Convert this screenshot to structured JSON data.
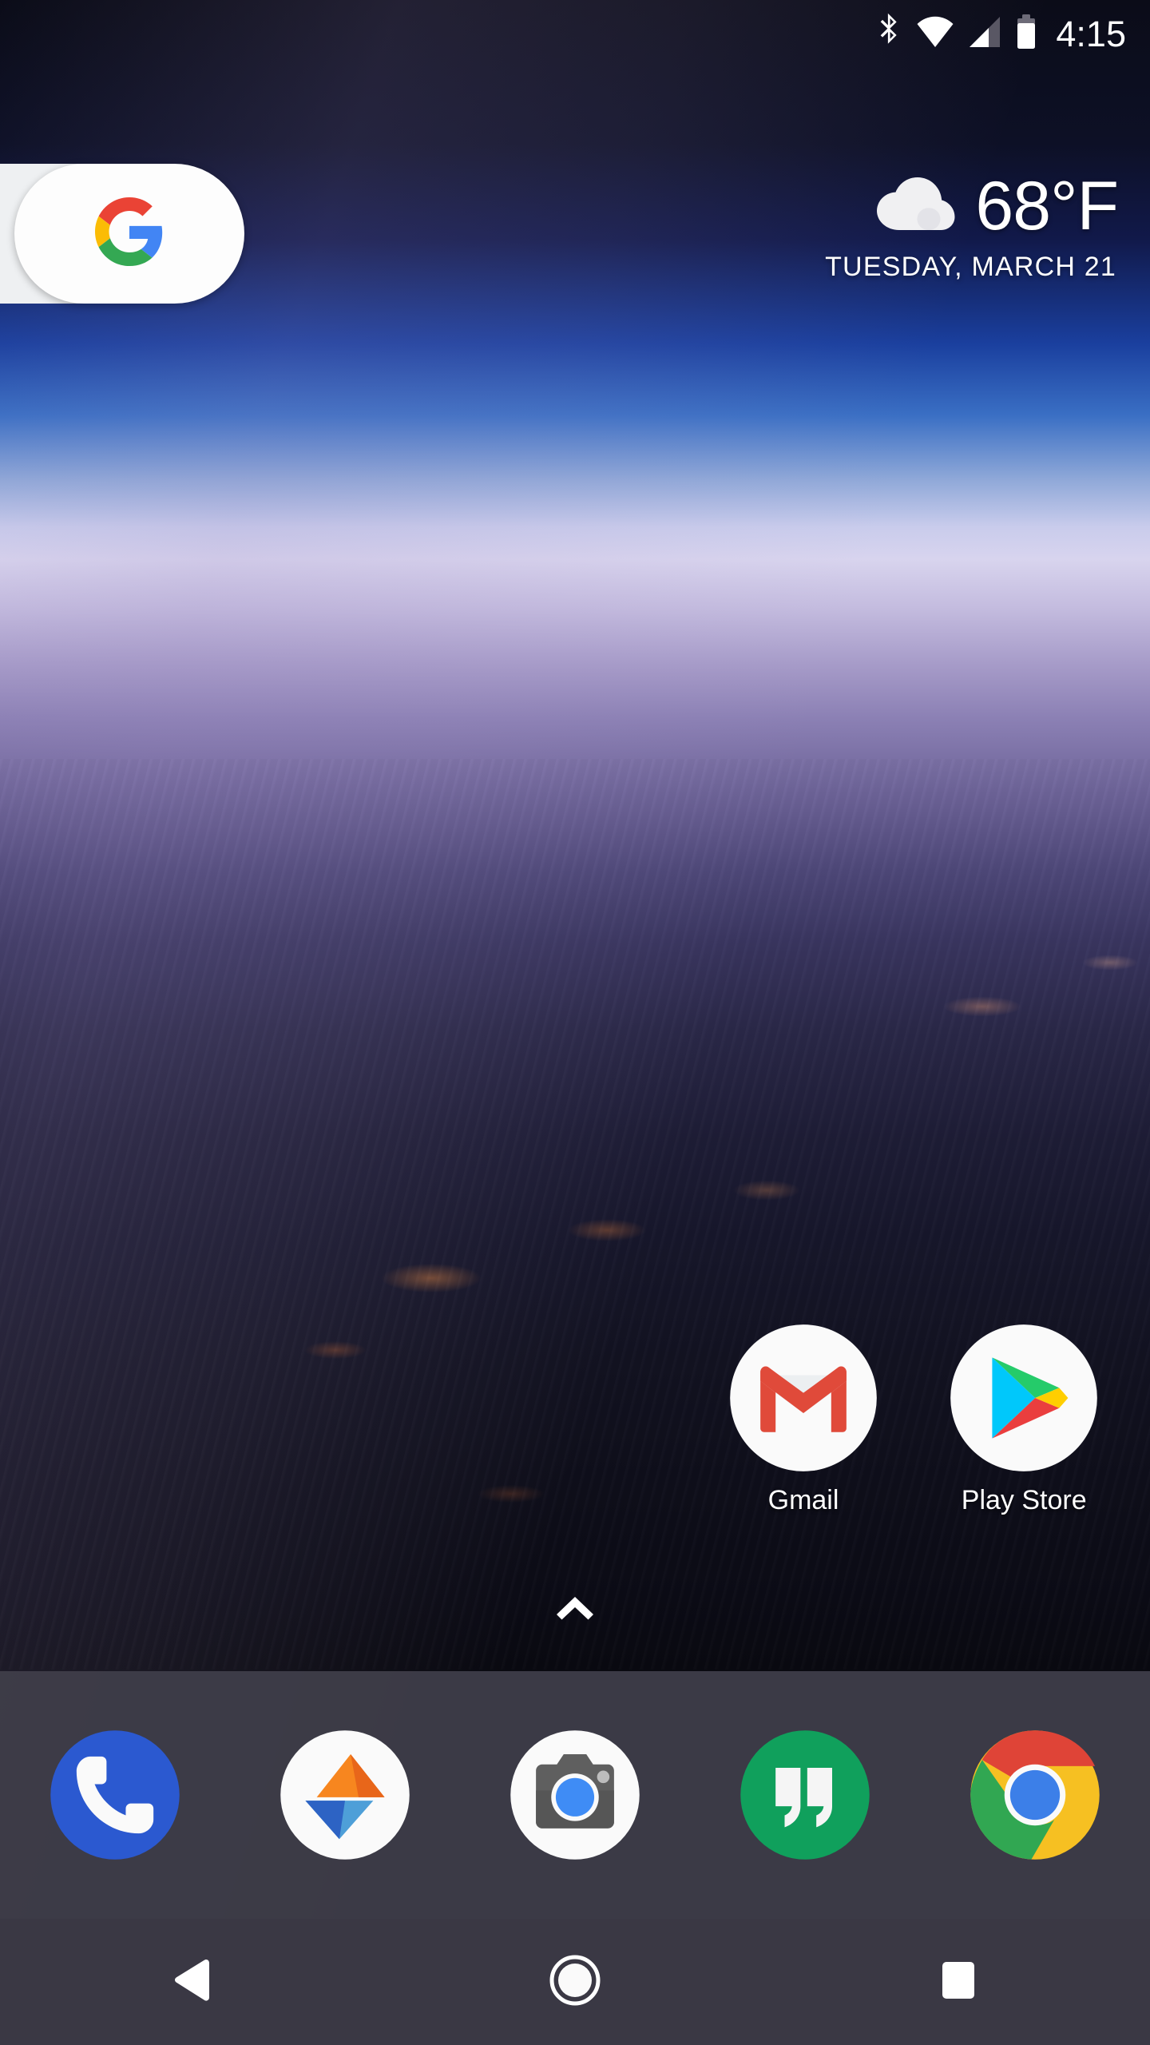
{
  "status_bar": {
    "time": "4:15",
    "icons": [
      {
        "name": "bluetooth-icon",
        "label": "Bluetooth"
      },
      {
        "name": "wifi-icon",
        "label": "Wi-Fi"
      },
      {
        "name": "cellular-signal-icon",
        "label": "Cellular signal"
      },
      {
        "name": "battery-icon",
        "label": "Battery"
      }
    ]
  },
  "search_widget": {
    "name": "google-search-pill",
    "icon": "google-g-icon",
    "label": "Google"
  },
  "weather_widget": {
    "icon": "cloud-icon",
    "temperature": "68°F",
    "date": "TUESDAY, MARCH 21"
  },
  "home_apps": [
    {
      "name": "gmail",
      "label": "Gmail",
      "icon": "gmail-icon"
    },
    {
      "name": "play-store",
      "label": "Play Store",
      "icon": "play-store-icon"
    }
  ],
  "drawer_handle": {
    "icon": "chevron-up-icon",
    "label": "Open app drawer"
  },
  "dock_apps": [
    {
      "name": "phone",
      "label": "Phone",
      "icon": "phone-icon"
    },
    {
      "name": "messaging",
      "label": "Messaging",
      "icon": "triangles-icon"
    },
    {
      "name": "camera",
      "label": "Camera",
      "icon": "camera-icon"
    },
    {
      "name": "hangouts",
      "label": "Hangouts",
      "icon": "hangouts-icon"
    },
    {
      "name": "chrome",
      "label": "Chrome",
      "icon": "chrome-icon"
    }
  ],
  "nav_bar": [
    {
      "name": "back-button",
      "label": "Back",
      "icon": "triangle-left-icon"
    },
    {
      "name": "home-button",
      "label": "Home",
      "icon": "circle-icon"
    },
    {
      "name": "recents-button",
      "label": "Recents",
      "icon": "square-icon"
    }
  ],
  "colors": {
    "google_blue": "#4285F4",
    "google_red": "#EA4335",
    "google_yellow": "#FBBC05",
    "google_green": "#34A853",
    "dock_bg": "#403E4A",
    "nav_bg": "#3A3844",
    "status_text": "#FFFFFF"
  }
}
